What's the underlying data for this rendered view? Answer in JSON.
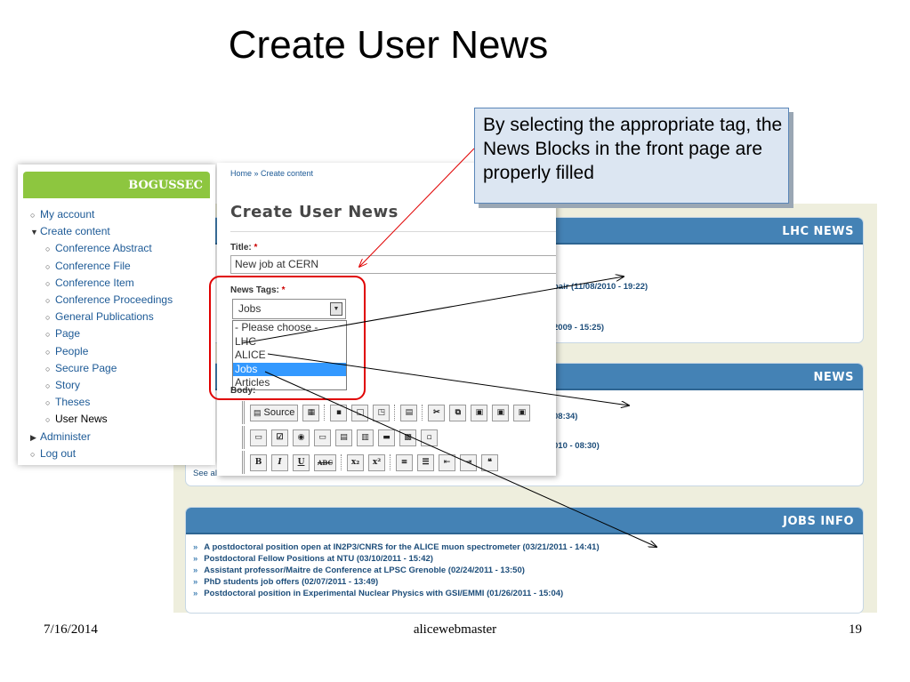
{
  "slide": {
    "title": "Create User News",
    "date": "7/16/2014",
    "author": "alicewebmaster",
    "page_number": "19"
  },
  "callout": {
    "text": "By selecting the appropriate tag, the News Blocks in the front page are properly filled"
  },
  "front_page": {
    "lhc_news": {
      "title": "LHC NEWS",
      "items": [
        "pair (11/08/2010 - 19:22)",
        "2009 - 15:25)"
      ]
    },
    "news": {
      "title": "NEWS",
      "items": [
        "08:34)",
        "010 - 08:30)"
      ],
      "see_all": "See all"
    },
    "jobs_info": {
      "title": "JOBS INFO",
      "bullet": "»",
      "items": [
        "A postdoctoral position open at IN2P3/CNRS for the ALICE muon spectrometer (03/21/2011 - 14:41)",
        "Postdoctoral Fellow Positions at NTU (03/10/2011 - 15:42)",
        "Assistant professor/Maitre de Conference at LPSC Grenoble (02/24/2011 - 13:50)",
        "PhD students job offers (02/07/2011 - 13:49)",
        "Postdoctoral position in Experimental Nuclear Physics with GSI/EMMI (01/26/2011 - 15:04)"
      ]
    }
  },
  "navigation": {
    "user_name": "BOGUSSEC",
    "items": [
      {
        "label": "My account",
        "marker": "○"
      },
      {
        "label": "Create content",
        "marker": "▼"
      },
      {
        "label": "Conference Abstract",
        "marker": "○"
      },
      {
        "label": "Conference File",
        "marker": "○"
      },
      {
        "label": "Conference Item",
        "marker": "○"
      },
      {
        "label": "Conference Proceedings",
        "marker": "○"
      },
      {
        "label": "General Publications",
        "marker": "○"
      },
      {
        "label": "Page",
        "marker": "○"
      },
      {
        "label": "People",
        "marker": "○"
      },
      {
        "label": "Secure Page",
        "marker": "○"
      },
      {
        "label": "Story",
        "marker": "○"
      },
      {
        "label": "Theses",
        "marker": "○"
      },
      {
        "label": "User News",
        "marker": "○"
      },
      {
        "label": "Administer",
        "marker": "▶"
      },
      {
        "label": "Log out",
        "marker": "○"
      }
    ]
  },
  "form": {
    "breadcrumb": "Home » Create content",
    "heading": "Create User News",
    "title_label": "Title:",
    "required_mark": "*",
    "title_value": "New job at CERN",
    "news_tags_label": "News Tags:",
    "selected_tag": "Jobs",
    "dropdown_arrow": "▼",
    "tag_options": [
      "- Please choose -",
      "LHC",
      "ALICE",
      "Jobs",
      "Articles"
    ],
    "body_label": "Body:",
    "toolbar": {
      "source": "Source",
      "bold": "B",
      "italic": "I",
      "underline": "U",
      "strike": "ABC",
      "subscript": "x₂",
      "superscript": "x²",
      "blockquote": "❝"
    }
  },
  "colors": {
    "block_header": "#4482b5",
    "nav_header": "#8dc63f",
    "link": "#1d5a96",
    "highlight": "#e00000",
    "callout_bg": "#dce6f2",
    "dropdown_selected": "#3399ff"
  }
}
